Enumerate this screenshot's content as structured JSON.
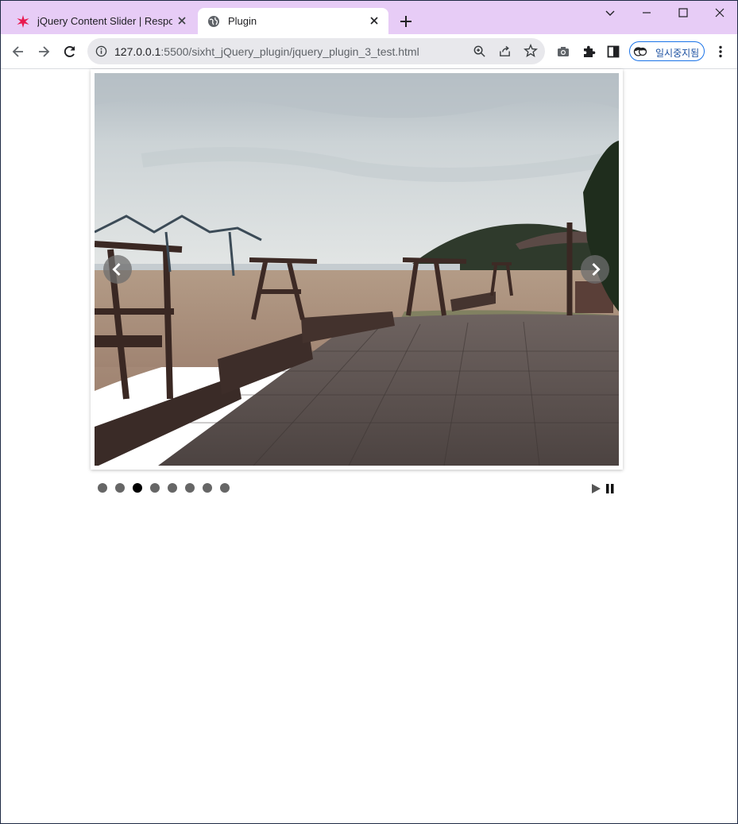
{
  "browser": {
    "tabs": [
      {
        "title": "jQuery Content Slider | Respons",
        "active": false
      },
      {
        "title": "Plugin",
        "active": true
      }
    ],
    "address": {
      "host": "127.0.0.1",
      "rest": ":5500/sixht_jQuery_plugin/jquery_plugin_3_test.html"
    },
    "profile_label": "일시중지됨"
  },
  "slider": {
    "pager_count": 8,
    "active_index": 2,
    "prev_icon": "chevron-left-icon",
    "next_icon": "chevron-right-icon",
    "controls": [
      "play-icon",
      "pause-icon"
    ]
  },
  "colors": {
    "tabstrip": "#e7ccf6",
    "dot": "#666666",
    "dot_active": "#000000"
  }
}
